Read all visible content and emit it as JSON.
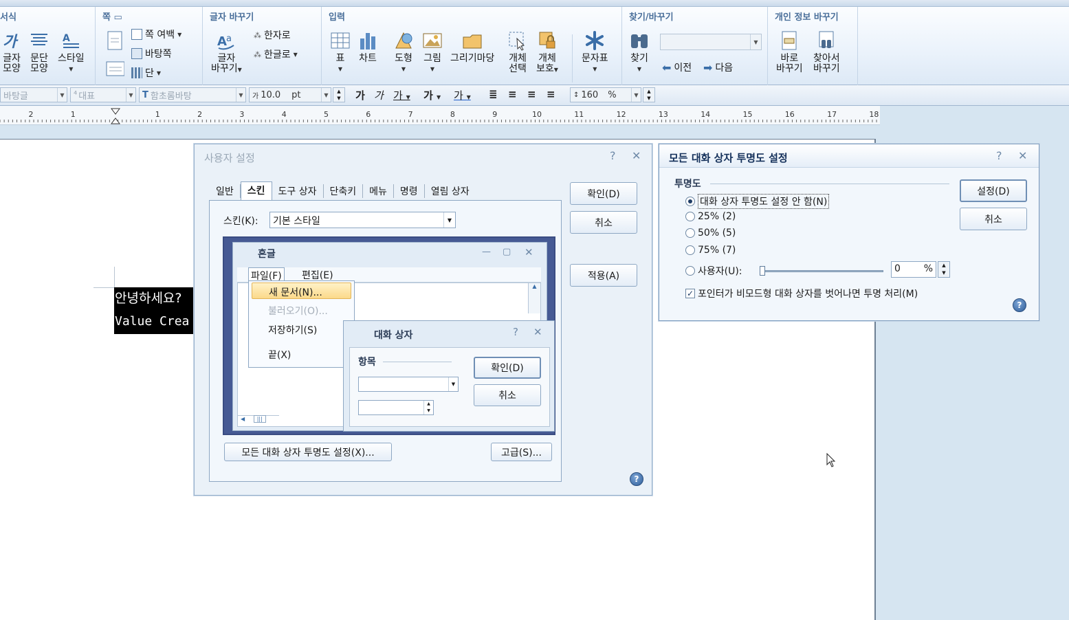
{
  "ribbon": {
    "groups": {
      "format": "서식",
      "page": "쪽",
      "convert": "글자 바꾸기",
      "input": "입력",
      "find": "찾기/바꾸기",
      "privacy": "개인 정보 바꾸기"
    },
    "buttons": {
      "char_shape": [
        "글자",
        "모양"
      ],
      "para_shape": [
        "문단",
        "모양"
      ],
      "style": "스타일",
      "margin": "쪽 여백",
      "bg_page": "바탕쪽",
      "columns": "단",
      "convert_char": [
        "글자",
        "바꾸기"
      ],
      "to_hanja": "한자로",
      "to_hangul": "한글로",
      "table": "표",
      "chart": "차트",
      "shape": "도형",
      "picture": "그림",
      "drawing_madang": "그리기마당",
      "select_obj": [
        "개체",
        "선택"
      ],
      "protect_obj": [
        "개체",
        "보호"
      ],
      "char_map": "문자표",
      "find": "찾기",
      "prev": "이전",
      "next": "다음",
      "replace_now": [
        "바로",
        "바꾸기"
      ],
      "find_replace": [
        "찾아서",
        "바꾸기"
      ]
    }
  },
  "format_bar": {
    "lang": "바탕글",
    "style": "대표",
    "font": "함초롬바탕",
    "size": "10.0",
    "unit": "pt",
    "line_spacing": "160",
    "ls_unit": "%"
  },
  "ruler": {
    "labels": [
      "2",
      "1",
      "1",
      "2",
      "3",
      "4",
      "5",
      "6",
      "7",
      "8",
      "9",
      "10",
      "11",
      "12",
      "13",
      "14",
      "15",
      "16",
      "17",
      "18"
    ]
  },
  "document": {
    "line1": "안녕하세요?",
    "line2": "Value Crea"
  },
  "user_settings": {
    "title": "사용자 설정",
    "tabs": [
      "일반",
      "스킨",
      "도구 상자",
      "단축키",
      "메뉴",
      "명령",
      "열림 상자"
    ],
    "skin_label": "스킨(K):",
    "skin_value": "기본 스타일",
    "ok": "확인(D)",
    "cancel": "취소",
    "apply": "적용(A)",
    "transparency_btn": "모든 대화 상자 투명도 설정(X)...",
    "advanced_btn": "고급(S)...",
    "preview": {
      "app_title": "흔글",
      "menu_file": "파일(F)",
      "menu_edit": "편집(E)",
      "items": [
        "새 문서(N)...",
        "불러오기(O)...",
        "저장하기(S)",
        "끝(X)"
      ],
      "dialog_title": "대화 상자",
      "group_label": "항목",
      "ok": "확인(D)",
      "cancel": "취소"
    }
  },
  "transparency": {
    "title": "모든 대화 상자 투명도 설정",
    "group": "투명도",
    "options": [
      "대화 상자 투명도 설정 안 함(N)",
      "25% (2)",
      "50% (5)",
      "75% (7)",
      "사용자(U):"
    ],
    "selected_index": 0,
    "custom_value": "0",
    "custom_unit": "%",
    "slider_level": 0,
    "checkbox": "포인터가 비모드형 대화 상자를 벗어나면 투명 처리(M)",
    "checkbox_checked": true,
    "set": "설정(D)",
    "cancel": "취소"
  }
}
